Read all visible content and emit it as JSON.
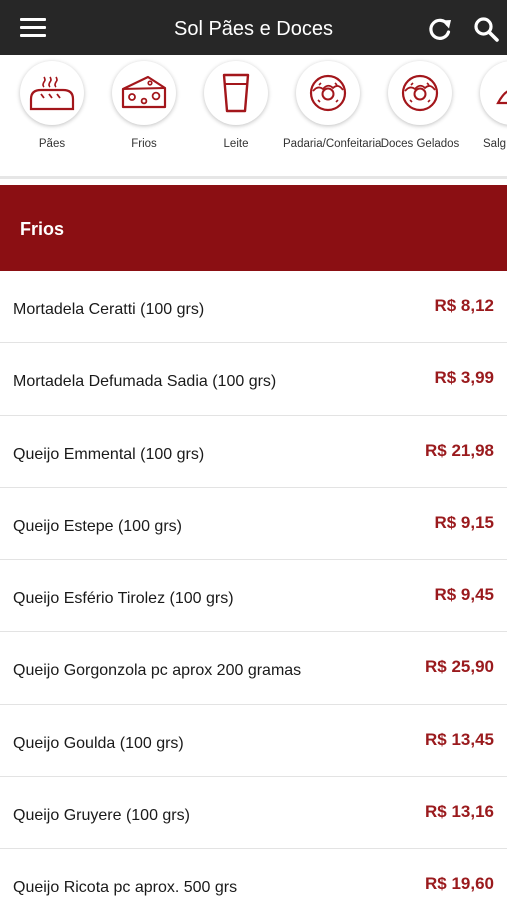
{
  "app": {
    "title": "Sol Pães e Doces"
  },
  "header": {
    "menu_icon": "hamburger-menu-icon",
    "refresh_icon": "refresh-icon",
    "search_icon": "search-icon"
  },
  "categories": [
    {
      "label": "Pães",
      "icon": "bread-icon"
    },
    {
      "label": "Frios",
      "icon": "cheese-icon"
    },
    {
      "label": "Leite",
      "icon": "glass-icon"
    },
    {
      "label": "Padaria/Confeitaria",
      "icon": "donut-icon"
    },
    {
      "label": "Doces Gelados",
      "icon": "donut-icon"
    },
    {
      "label": "Salg",
      "icon": "snack-icon"
    }
  ],
  "section": {
    "title": "Frios"
  },
  "products": [
    {
      "name": "Mortadela Ceratti (100 grs)",
      "price": "R$ 8,12"
    },
    {
      "name": "Mortadela Defumada Sadia (100 grs)",
      "price": "R$ 3,99"
    },
    {
      "name": "Queijo Emmental (100 grs)",
      "price": "R$ 21,98"
    },
    {
      "name": "Queijo Estepe (100 grs)",
      "price": "R$ 9,15"
    },
    {
      "name": "Queijo Esfério Tirolez (100 grs)",
      "price": "R$ 9,45"
    },
    {
      "name": "Queijo Gorgonzola pc aprox 200 gramas",
      "price": "R$ 25,90"
    },
    {
      "name": "Queijo Goulda (100 grs)",
      "price": "R$ 13,45"
    },
    {
      "name": "Queijo Gruyere (100 grs)",
      "price": "R$ 13,16"
    },
    {
      "name": "Queijo Ricota pc aprox. 500 grs",
      "price": "R$ 19,60"
    }
  ],
  "colors": {
    "topbar": "#272727",
    "section_header": "#8b0f13",
    "price": "#9a1a1d",
    "icon_stroke": "#a3161b"
  }
}
